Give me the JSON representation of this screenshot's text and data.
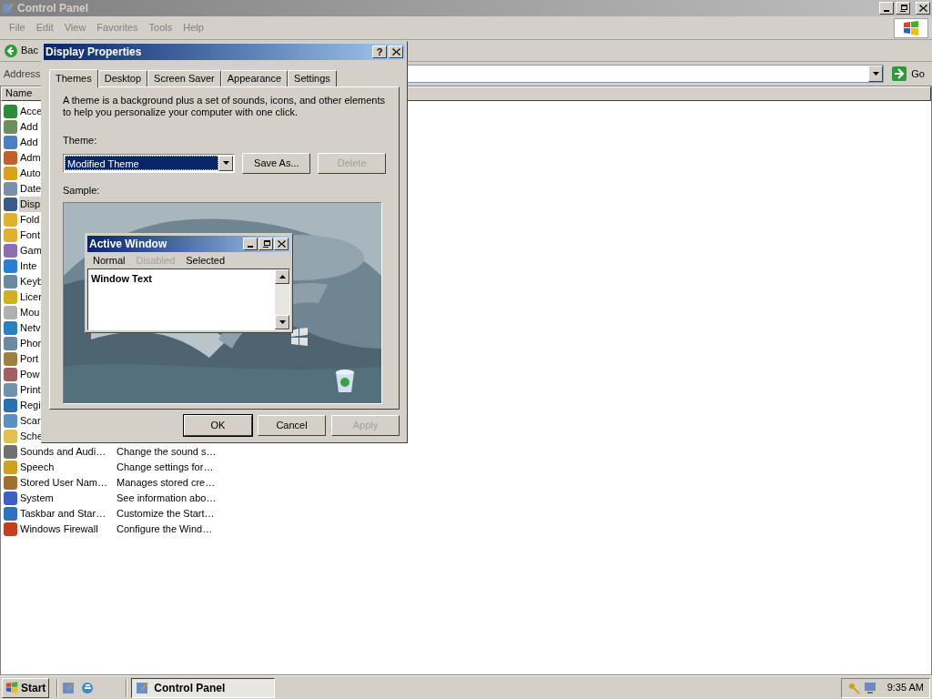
{
  "window": {
    "title": "Control Panel"
  },
  "menu": [
    "File",
    "Edit",
    "View",
    "Favorites",
    "Tools",
    "Help"
  ],
  "toolbar": {
    "back": "Bac"
  },
  "address": {
    "label": "Address",
    "go": "Go"
  },
  "list": {
    "column": "Name",
    "rows": [
      {
        "name": "Acce",
        "selected": false
      },
      {
        "name": "Add",
        "selected": false
      },
      {
        "name": "Add",
        "selected": false
      },
      {
        "name": "Adm",
        "selected": false
      },
      {
        "name": "Auto",
        "selected": false
      },
      {
        "name": "Date",
        "selected": false
      },
      {
        "name": "Disp",
        "selected": true
      },
      {
        "name": "Fold",
        "selected": false
      },
      {
        "name": "Font",
        "selected": false
      },
      {
        "name": "Gam",
        "selected": false
      },
      {
        "name": "Inte",
        "selected": false
      },
      {
        "name": "Keyb",
        "selected": false
      },
      {
        "name": "Licer",
        "selected": false
      },
      {
        "name": "Mou",
        "selected": false
      },
      {
        "name": "Netv",
        "selected": false
      },
      {
        "name": "Phor",
        "selected": false
      },
      {
        "name": "Port",
        "selected": false
      },
      {
        "name": "Pow",
        "selected": false
      },
      {
        "name": "Print",
        "selected": false
      },
      {
        "name": "Regi",
        "selected": false
      },
      {
        "name": "Scar",
        "selected": false
      },
      {
        "name": "Sche",
        "selected": false
      },
      {
        "name": "Sounds and Audi…",
        "description": "Change the sound s…",
        "selected": false
      },
      {
        "name": "Speech",
        "description": "Change settings for…",
        "selected": false
      },
      {
        "name": "Stored User Nam…",
        "description": "Manages stored cre…",
        "selected": false
      },
      {
        "name": "System",
        "description": "See information abo…",
        "selected": false
      },
      {
        "name": "Taskbar and Star…",
        "description": "Customize the Start…",
        "selected": false
      },
      {
        "name": "Windows Firewall",
        "description": "Configure the Wind…",
        "selected": false
      }
    ]
  },
  "dialog": {
    "title": "Display Properties",
    "help": "?",
    "tabs": [
      {
        "label": "Themes",
        "selected": true
      },
      {
        "label": "Desktop",
        "selected": false
      },
      {
        "label": "Screen Saver",
        "selected": false
      },
      {
        "label": "Appearance",
        "selected": false
      },
      {
        "label": "Settings",
        "selected": false
      }
    ],
    "intro": "A theme is a background plus a set of sounds, icons, and other elements to help you personalize your computer with one click.",
    "theme_label": "Theme:",
    "theme_value": "Modified Theme",
    "theme_buttons": [
      {
        "label": "Save As...",
        "disabled": false
      },
      {
        "label": "Delete",
        "disabled": true
      }
    ],
    "sample_label": "Sample:",
    "preview": {
      "title": "Active Window",
      "menu": [
        {
          "label": "Normal",
          "kind": "normal"
        },
        {
          "label": "Disabled",
          "kind": "disabled"
        },
        {
          "label": "Selected",
          "kind": "selected"
        }
      ],
      "text": "Window Text"
    },
    "buttons": [
      {
        "label": "OK",
        "disabled": false
      },
      {
        "label": "Cancel",
        "disabled": false
      },
      {
        "label": "Apply",
        "disabled": true
      }
    ]
  },
  "taskbar": {
    "start": "Start",
    "tasks": [
      {
        "label": "Control Panel",
        "selected": true
      }
    ],
    "clock": "9:35 AM"
  }
}
